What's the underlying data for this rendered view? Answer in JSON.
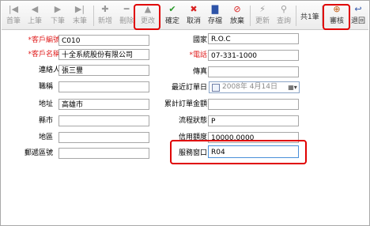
{
  "toolbar": {
    "buttons": [
      {
        "icon": "|◀",
        "label": "首筆"
      },
      {
        "icon": "◀",
        "label": "上筆"
      },
      {
        "icon": "▶",
        "label": "下筆"
      },
      {
        "icon": "▶|",
        "label": "末筆"
      },
      {
        "icon": "✚",
        "label": "新增"
      },
      {
        "icon": "━",
        "label": "刪除"
      },
      {
        "icon": "▲",
        "label": "更改"
      },
      {
        "icon": "✔",
        "label": "確定"
      },
      {
        "icon": "✖",
        "label": "取消"
      },
      {
        "icon": "▇",
        "label": "存檔"
      },
      {
        "icon": "⊘",
        "label": "放棄"
      },
      {
        "icon": "⚡",
        "label": "更新"
      },
      {
        "icon": "⚲",
        "label": "查詢"
      },
      {
        "icon": "⊕",
        "label": "審核"
      },
      {
        "icon": "↩",
        "label": "退回"
      }
    ],
    "record_count": "共1筆"
  },
  "form": {
    "customer_code_label": "*客戶編號",
    "customer_code": "C010",
    "country_label": "國家",
    "country": "R.O.C",
    "customer_name_label": "*客戶名稱",
    "customer_name": "十全系統股份有限公司",
    "phone_label": "*電話",
    "phone": "07-331-1000",
    "contact_label": "連絡人",
    "contact": "張三豐",
    "fax_label": "傳真",
    "fax": "",
    "title_label": "職稱",
    "title": "",
    "last_order_label": "最近訂單日",
    "last_order_date": "2008年 4月14日",
    "address_label": "地址",
    "address": "高雄市",
    "total_order_label": "累計訂單金額",
    "total_order": "",
    "city_label": "縣市",
    "city": "",
    "workflow_label": "流程狀態",
    "workflow": "P",
    "region_label": "地區",
    "region": "",
    "credit_label": "信用額度",
    "credit": "10000.0000",
    "zip_label": "郵遞區號",
    "zip": "",
    "window_label": "服務窗口",
    "window": "R04"
  }
}
